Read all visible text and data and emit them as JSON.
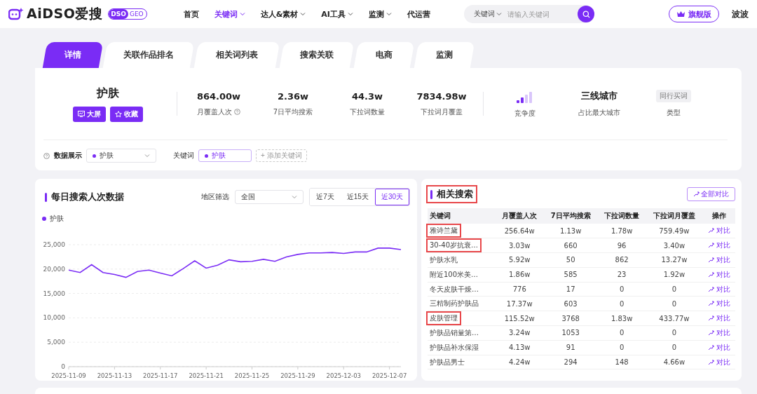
{
  "header": {
    "logo": "AiDSO爱搜",
    "logo_badge": {
      "strong": "DSO",
      "light": "GEO"
    },
    "nav": [
      {
        "label": "首页",
        "selected": false,
        "dropdown": false
      },
      {
        "label": "关键词",
        "selected": true,
        "dropdown": true
      },
      {
        "label": "达人&素材",
        "selected": false,
        "dropdown": true
      },
      {
        "label": "AI工具",
        "selected": false,
        "dropdown": true
      },
      {
        "label": "监测",
        "selected": false,
        "dropdown": true
      },
      {
        "label": "代运营",
        "selected": false,
        "dropdown": false
      }
    ],
    "search": {
      "scope": "关键词",
      "placeholder": "请输入关键词"
    },
    "plan_button": "旗舰版",
    "user": "波波"
  },
  "tabs": [
    {
      "label": "详情",
      "selected": true
    },
    {
      "label": "关联作品排名",
      "selected": false
    },
    {
      "label": "相关词列表",
      "selected": false
    },
    {
      "label": "搜索关联",
      "selected": false
    },
    {
      "label": "电商",
      "selected": false
    },
    {
      "label": "监测",
      "selected": false
    }
  ],
  "summary": {
    "keyword": "护肤",
    "buttons": [
      "大屏",
      "收藏"
    ],
    "stats": [
      {
        "kind": "value",
        "value": "864.00w",
        "label": "月覆盖人次",
        "help": true
      },
      {
        "kind": "value",
        "value": "2.36w",
        "label": "7日平均搜索",
        "help": false
      },
      {
        "kind": "value",
        "value": "44.3w",
        "label": "下拉词数量",
        "help": false
      },
      {
        "kind": "value",
        "value": "7834.98w",
        "label": "下拉词月覆盖",
        "help": false
      },
      {
        "kind": "bars",
        "label": "竞争度"
      },
      {
        "kind": "value",
        "value": "三线城市",
        "label": "占比最大城市",
        "help": false
      },
      {
        "kind": "tag",
        "value": "同行买词",
        "label": "类型"
      }
    ],
    "filter": {
      "label": "数据展示",
      "select": "护肤",
      "keyword_label": "关键词",
      "keywords": [
        "护肤"
      ],
      "add_button": "+ 添加关键词"
    }
  },
  "trend": {
    "title": "每日搜索人次数据",
    "region_label": "地区筛选",
    "region": "全国",
    "ranges": [
      {
        "label": "近7天",
        "selected": false
      },
      {
        "label": "近15天",
        "selected": false
      },
      {
        "label": "近30天",
        "selected": true
      }
    ],
    "chart_data": {
      "type": "line",
      "categories": [
        "2025-11-09",
        null,
        null,
        null,
        "2025-11-13",
        null,
        null,
        null,
        "2025-11-17",
        null,
        null,
        null,
        "2025-11-21",
        null,
        null,
        null,
        "2025-11-25",
        null,
        null,
        null,
        "2025-11-29",
        null,
        null,
        null,
        "2025-12-03",
        null,
        null,
        null,
        "2025-12-07",
        null
      ],
      "series": [
        {
          "name": "护肤",
          "color": "#7a2cf5",
          "values": [
            19800,
            19300,
            20900,
            19300,
            18900,
            18300,
            19500,
            19800,
            19200,
            18600,
            20100,
            21700,
            20200,
            20800,
            21900,
            21500,
            21600,
            22000,
            21600,
            22500,
            23000,
            23300,
            23300,
            23400,
            23200,
            23500,
            23500,
            24300,
            24300,
            24000
          ]
        }
      ],
      "grid": true,
      "ylim": [
        0,
        25000
      ],
      "yticks": [
        {
          "value": 0,
          "label": "0"
        },
        {
          "value": 5000,
          "label": "5,000"
        },
        {
          "value": 10000,
          "label": "10,000"
        },
        {
          "value": 15000,
          "label": "15,000"
        },
        {
          "value": 20000,
          "label": "20,000"
        },
        {
          "value": 25000,
          "label": "25,000"
        }
      ]
    }
  },
  "related": {
    "title": "相关搜索",
    "title_highlighted": true,
    "compare_all": "全部对比",
    "columns": [
      "关键词",
      "月覆盖人次",
      "7日平均搜索",
      "下拉词数量",
      "下拉词月覆盖",
      "操作"
    ],
    "rows": [
      {
        "cells": [
          "雅诗兰黛",
          "256.64w",
          "1.13w",
          "1.78w",
          "759.49w"
        ],
        "action": "对比",
        "highlighted": true
      },
      {
        "cells": [
          "30-40岁抗衰…",
          "3.03w",
          "660",
          "96",
          "3.40w"
        ],
        "action": "对比",
        "highlighted": true
      },
      {
        "cells": [
          "护肤水乳",
          "5.92w",
          "50",
          "862",
          "13.27w"
        ],
        "action": "对比",
        "highlighted": false
      },
      {
        "cells": [
          "附近100米美…",
          "1.86w",
          "585",
          "23",
          "1.92w"
        ],
        "action": "对比",
        "highlighted": false
      },
      {
        "cells": [
          "冬天皮肤干燥…",
          "776",
          "17",
          "0",
          "0"
        ],
        "action": "对比",
        "highlighted": false
      },
      {
        "cells": [
          "三精制药护肤品",
          "17.37w",
          "603",
          "0",
          "0"
        ],
        "action": "对比",
        "highlighted": false
      },
      {
        "cells": [
          "皮肤管理",
          "115.52w",
          "3768",
          "1.83w",
          "433.77w"
        ],
        "action": "对比",
        "highlighted": true
      },
      {
        "cells": [
          "护肤品销量第…",
          "3.24w",
          "1053",
          "0",
          "0"
        ],
        "action": "对比",
        "highlighted": false
      },
      {
        "cells": [
          "护肤品补水保湿",
          "4.13w",
          "91",
          "0",
          "0"
        ],
        "action": "对比",
        "highlighted": false
      },
      {
        "cells": [
          "护肤品男士",
          "4.24w",
          "294",
          "148",
          "4.66w"
        ],
        "action": "对比",
        "highlighted": false
      }
    ]
  }
}
